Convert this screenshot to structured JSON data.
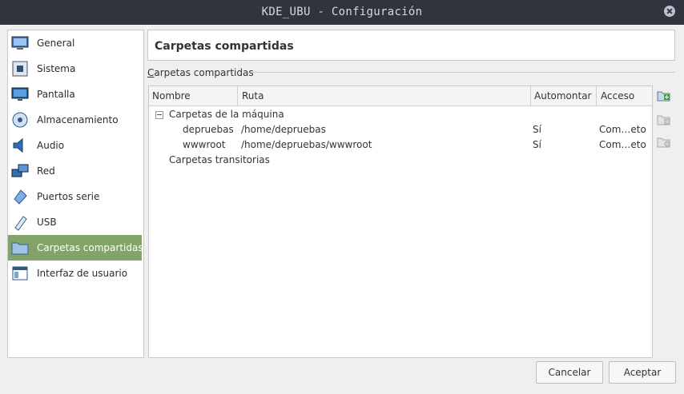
{
  "window": {
    "title": "KDE_UBU - Configuración"
  },
  "sidebar": {
    "items": [
      {
        "label": "General",
        "icon": "general-monitor-icon"
      },
      {
        "label": "Sistema",
        "icon": "system-chip-icon"
      },
      {
        "label": "Pantalla",
        "icon": "display-monitor-icon"
      },
      {
        "label": "Almacenamiento",
        "icon": "storage-disc-icon"
      },
      {
        "label": "Audio",
        "icon": "audio-speaker-icon"
      },
      {
        "label": "Red",
        "icon": "network-icon"
      },
      {
        "label": "Puertos serie",
        "icon": "serial-port-icon"
      },
      {
        "label": "USB",
        "icon": "usb-icon"
      },
      {
        "label": "Carpetas compartidas",
        "icon": "shared-folder-icon",
        "selected": true
      },
      {
        "label": "Interfaz de usuario",
        "icon": "user-interface-icon"
      }
    ]
  },
  "page": {
    "title": "Carpetas compartidas"
  },
  "group": {
    "label_prefix": "C",
    "label_rest": "arpetas compartidas"
  },
  "table": {
    "columns": [
      "Nombre",
      "Ruta",
      "Automontar",
      "Acceso"
    ],
    "machine_group": "Carpetas de la máquina",
    "rows": [
      {
        "name": "depruebas",
        "path": "/home/depruebas",
        "automount": "Sí",
        "access": "Com…eto"
      },
      {
        "name": "wwwroot",
        "path": "/home/depruebas/wwwroot",
        "automount": "Sí",
        "access": "Com…eto"
      }
    ],
    "transient_group": "Carpetas transitorias"
  },
  "tools": [
    "add-folder-icon",
    "edit-folder-icon",
    "remove-folder-icon"
  ],
  "buttons": {
    "cancel": "Cancelar",
    "accept": "Aceptar"
  },
  "colors": {
    "selection": "#84a36a",
    "titlebar": "#2f343f"
  }
}
